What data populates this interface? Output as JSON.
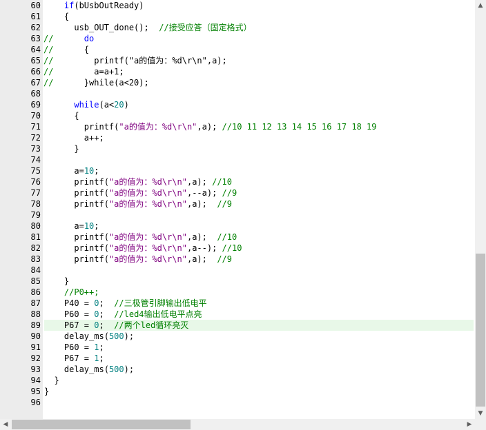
{
  "lines": [
    {
      "n": "60",
      "marker": "",
      "indent": "    ",
      "segs": [
        [
          "kw",
          "if"
        ],
        [
          "t",
          "(bUsbOutReady)"
        ]
      ]
    },
    {
      "n": "61",
      "marker": "",
      "indent": "    ",
      "segs": [
        [
          "t",
          "{"
        ]
      ]
    },
    {
      "n": "62",
      "marker": "",
      "indent": "      ",
      "segs": [
        [
          "t",
          "usb_OUT_done();  "
        ],
        [
          "com",
          "//接受应答（固定格式）"
        ]
      ]
    },
    {
      "n": "63",
      "marker": "//",
      "indent": "        ",
      "segs": [
        [
          "kw",
          "do"
        ]
      ]
    },
    {
      "n": "64",
      "marker": "//",
      "indent": "        ",
      "segs": [
        [
          "t",
          "{"
        ]
      ]
    },
    {
      "n": "65",
      "marker": "//",
      "indent": "          ",
      "segs": [
        [
          "t",
          "printf(\"a的值为：%d\\r\\n\",a);"
        ]
      ]
    },
    {
      "n": "66",
      "marker": "//",
      "indent": "          ",
      "segs": [
        [
          "t",
          "a=a+1;"
        ]
      ]
    },
    {
      "n": "67",
      "marker": "//",
      "indent": "        ",
      "segs": [
        [
          "t",
          "}while(a<20);"
        ]
      ]
    },
    {
      "n": "68",
      "marker": "",
      "indent": "",
      "segs": []
    },
    {
      "n": "69",
      "marker": "",
      "indent": "      ",
      "segs": [
        [
          "kw",
          "while"
        ],
        [
          "t",
          "(a<"
        ],
        [
          "num",
          "20"
        ],
        [
          "t",
          ")"
        ]
      ]
    },
    {
      "n": "70",
      "marker": "",
      "indent": "      ",
      "segs": [
        [
          "t",
          "{"
        ]
      ]
    },
    {
      "n": "71",
      "marker": "",
      "indent": "        ",
      "segs": [
        [
          "t",
          "printf("
        ],
        [
          "str",
          "\"a的值为：%d\\r\\n\""
        ],
        [
          "t",
          ",a); "
        ],
        [
          "com",
          "//10 11 12 13 14 15 16 17 18 19"
        ]
      ]
    },
    {
      "n": "72",
      "marker": "",
      "indent": "        ",
      "segs": [
        [
          "t",
          "a++;"
        ]
      ]
    },
    {
      "n": "73",
      "marker": "",
      "indent": "      ",
      "segs": [
        [
          "t",
          "}"
        ]
      ]
    },
    {
      "n": "74",
      "marker": "",
      "indent": "",
      "segs": []
    },
    {
      "n": "75",
      "marker": "",
      "indent": "      ",
      "segs": [
        [
          "t",
          "a="
        ],
        [
          "num",
          "10"
        ],
        [
          "t",
          ";"
        ]
      ]
    },
    {
      "n": "76",
      "marker": "",
      "indent": "      ",
      "segs": [
        [
          "t",
          "printf("
        ],
        [
          "str",
          "\"a的值为：%d\\r\\n\""
        ],
        [
          "t",
          ",a); "
        ],
        [
          "com",
          "//10"
        ]
      ]
    },
    {
      "n": "77",
      "marker": "",
      "indent": "      ",
      "segs": [
        [
          "t",
          "printf("
        ],
        [
          "str",
          "\"a的值为：%d\\r\\n\""
        ],
        [
          "t",
          ",--a); "
        ],
        [
          "com",
          "//9"
        ]
      ]
    },
    {
      "n": "78-dummy",
      "skip": true
    },
    {
      "n": "78",
      "marker": "",
      "indent": "      ",
      "segs": [
        [
          "t",
          "printf("
        ],
        [
          "str",
          "\"a的值为：%d\\r\\n\""
        ],
        [
          "t",
          ",a);  "
        ],
        [
          "com",
          "//9"
        ]
      ]
    },
    {
      "n": "79",
      "marker": "",
      "indent": "",
      "segs": []
    },
    {
      "n": "80",
      "marker": "",
      "indent": "      ",
      "segs": [
        [
          "t",
          "a="
        ],
        [
          "num",
          "10"
        ],
        [
          "t",
          ";"
        ]
      ]
    },
    {
      "n": "81",
      "marker": "",
      "indent": "      ",
      "segs": [
        [
          "t",
          "printf("
        ],
        [
          "str",
          "\"a的值为：%d\\r\\n\""
        ],
        [
          "t",
          ",a);  "
        ],
        [
          "com",
          "//10"
        ]
      ]
    },
    {
      "n": "82",
      "marker": "",
      "indent": "      ",
      "segs": [
        [
          "t",
          "printf("
        ],
        [
          "str",
          "\"a的值为：%d\\r\\n\""
        ],
        [
          "t",
          ",a--); "
        ],
        [
          "com",
          "//10"
        ]
      ]
    },
    {
      "n": "83",
      "marker": "",
      "indent": "      ",
      "segs": [
        [
          "t",
          "printf("
        ],
        [
          "str",
          "\"a的值为：%d\\r\\n\""
        ],
        [
          "t",
          ",a);  "
        ],
        [
          "com",
          "//9"
        ]
      ]
    },
    {
      "n": "84",
      "marker": "",
      "indent": "",
      "segs": []
    },
    {
      "n": "85",
      "marker": "",
      "indent": "    ",
      "segs": [
        [
          "t",
          "}"
        ]
      ]
    },
    {
      "n": "86",
      "marker": "",
      "indent": "    ",
      "segs": [
        [
          "com",
          "//P0++;"
        ]
      ]
    },
    {
      "n": "87",
      "marker": "",
      "indent": "    ",
      "segs": [
        [
          "t",
          "P40 = "
        ],
        [
          "num",
          "0"
        ],
        [
          "t",
          ";  "
        ],
        [
          "com",
          "//三极管引脚输出低电平"
        ]
      ]
    },
    {
      "n": "88",
      "marker": "",
      "indent": "    ",
      "segs": [
        [
          "t",
          "P60 = "
        ],
        [
          "num",
          "0"
        ],
        [
          "t",
          ";  "
        ],
        [
          "com",
          "//led4输出低电平点亮"
        ]
      ]
    },
    {
      "n": "89",
      "marker": "",
      "indent": "    ",
      "hl": true,
      "segs": [
        [
          "t",
          "P67 = "
        ],
        [
          "num",
          "0"
        ],
        [
          "t",
          ";  "
        ],
        [
          "com",
          "//两个led循环亮灭"
        ]
      ]
    },
    {
      "n": "90",
      "marker": "",
      "indent": "    ",
      "segs": [
        [
          "t",
          "delay_ms("
        ],
        [
          "num",
          "500"
        ],
        [
          "t",
          ");"
        ]
      ]
    },
    {
      "n": "91",
      "marker": "",
      "indent": "    ",
      "segs": [
        [
          "t",
          "P60 = "
        ],
        [
          "num",
          "1"
        ],
        [
          "t",
          ";"
        ]
      ]
    },
    {
      "n": "92",
      "marker": "",
      "indent": "    ",
      "segs": [
        [
          "t",
          "P67 = "
        ],
        [
          "num",
          "1"
        ],
        [
          "t",
          ";"
        ]
      ]
    },
    {
      "n": "93",
      "marker": "",
      "indent": "    ",
      "segs": [
        [
          "t",
          "delay_ms("
        ],
        [
          "num",
          "500"
        ],
        [
          "t",
          ");"
        ]
      ]
    },
    {
      "n": "94",
      "marker": "",
      "indent": "  ",
      "segs": [
        [
          "t",
          "}"
        ]
      ]
    },
    {
      "n": "95",
      "marker": "",
      "indent": "",
      "segs": [
        [
          "t",
          "}"
        ]
      ]
    },
    {
      "n": "96",
      "marker": "",
      "indent": "",
      "segs": []
    }
  ],
  "scroll": {
    "up_arrow": "▲",
    "down_arrow": "▼",
    "left_arrow": "◀",
    "right_arrow": "▶"
  },
  "colors": {
    "keyword": "#0000ff",
    "string": "#7f007f",
    "number": "#008080",
    "comment": "#008000",
    "highlight": "#e8f8e8",
    "gutter": "#ececec"
  }
}
